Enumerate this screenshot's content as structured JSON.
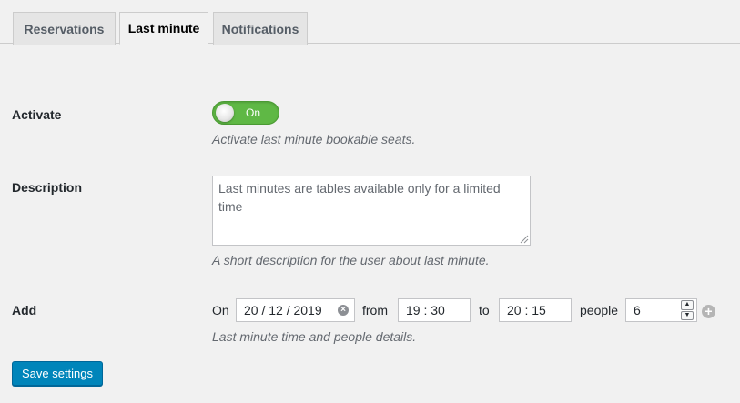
{
  "tabs": [
    {
      "label": "Reservations",
      "active": false
    },
    {
      "label": "Last minute",
      "active": true
    },
    {
      "label": "Notifications",
      "active": false
    }
  ],
  "activate": {
    "label": "Activate",
    "toggle_state": "On",
    "description": "Activate last minute bookable seats."
  },
  "description": {
    "label": "Description",
    "value": "Last minutes are tables available only for a limited time",
    "help": "A short description for the user about last minute."
  },
  "add": {
    "label": "Add",
    "on_label": "On",
    "date_value": "20 / 12 / 2019",
    "from_label": "from",
    "from_value": "19 : 30",
    "to_label": "to",
    "to_value": "20 : 15",
    "people_label": "people",
    "people_value": "6",
    "help": "Last minute time and people details."
  },
  "save_label": "Save settings",
  "colors": {
    "toggle_on": "#5fb845",
    "primary_button": "#0085ba",
    "background": "#f1f1f1"
  }
}
